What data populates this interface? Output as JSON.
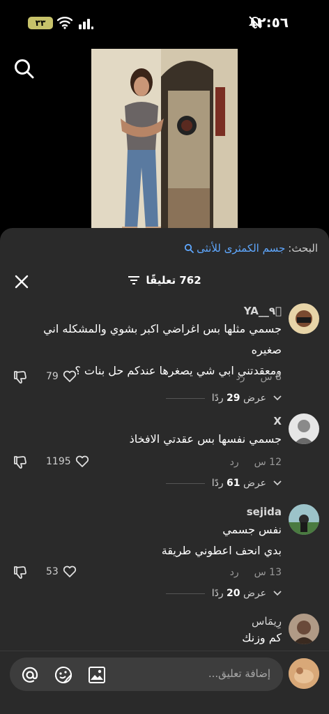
{
  "status_bar": {
    "time": "١٢:٥٦",
    "battery": "٣٣"
  },
  "search": {
    "label": "البحث:",
    "term": "جسم الكمثرى للأنثى"
  },
  "comments_header": {
    "count_label": "762 تعليقًا"
  },
  "comments": [
    {
      "username": "‏YA__٩ؘ",
      "lines": [
        "جسمي مثلها بس اغراضي اكبر بشوي والمشكله اني صغيره",
        "ومعقدتني ابي شي يصغرها عندكم حل بنات ؟"
      ],
      "time": "8 س",
      "reply": "رد",
      "likes": "79",
      "replies_prefix": "عرض",
      "replies_count": "29",
      "replies_suffix": "ردًا"
    },
    {
      "username": "X",
      "lines": [
        "جسمي نفسها بس عقدتي الافخاذ"
      ],
      "time": "12 س",
      "reply": "رد",
      "likes": "1195",
      "replies_prefix": "عرض",
      "replies_count": "61",
      "replies_suffix": "ردًا"
    },
    {
      "username": "sejida",
      "lines": [
        "نفس جسمي",
        "بدي انحف اعطوني طريقة"
      ],
      "time": "13 س",
      "reply": "رد",
      "likes": "53",
      "replies_prefix": "عرض",
      "replies_count": "20",
      "replies_suffix": "ردًا"
    },
    {
      "username": "رِيمَاس",
      "lines": [
        "كم وزنك"
      ]
    }
  ],
  "input": {
    "placeholder": "إضافة تعليق..."
  },
  "colors": {
    "sheet_bg": "#2a2a2a",
    "link_blue": "#5fa8ff",
    "battery": "#c7c26a"
  },
  "icons": [
    "search-icon",
    "close-icon",
    "filter-icon",
    "heart-icon",
    "dislike-icon",
    "chevron-down-icon",
    "at-icon",
    "emoji-icon",
    "image-icon",
    "mute-icon",
    "wifi-icon",
    "signal-icon"
  ]
}
